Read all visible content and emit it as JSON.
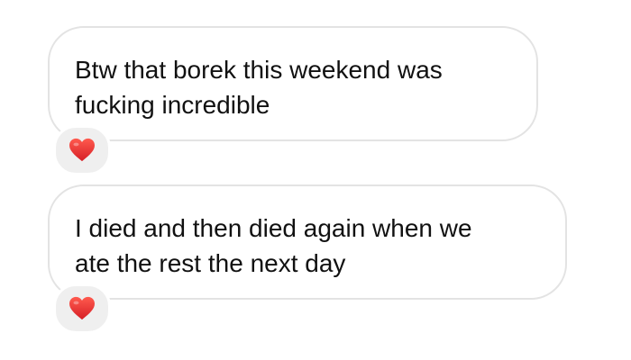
{
  "conversation": {
    "messages": [
      {
        "text": "Btw that borek this weekend was\nfucking incredible",
        "reaction": "heart-icon"
      },
      {
        "text": "I died and then died again when we\nate the rest the next day",
        "reaction": "heart-icon"
      }
    ]
  },
  "colors": {
    "bubble_border": "#e3e3e3",
    "bubble_text": "#111111",
    "reaction_background": "#efefef",
    "heart": "#e0322f"
  }
}
